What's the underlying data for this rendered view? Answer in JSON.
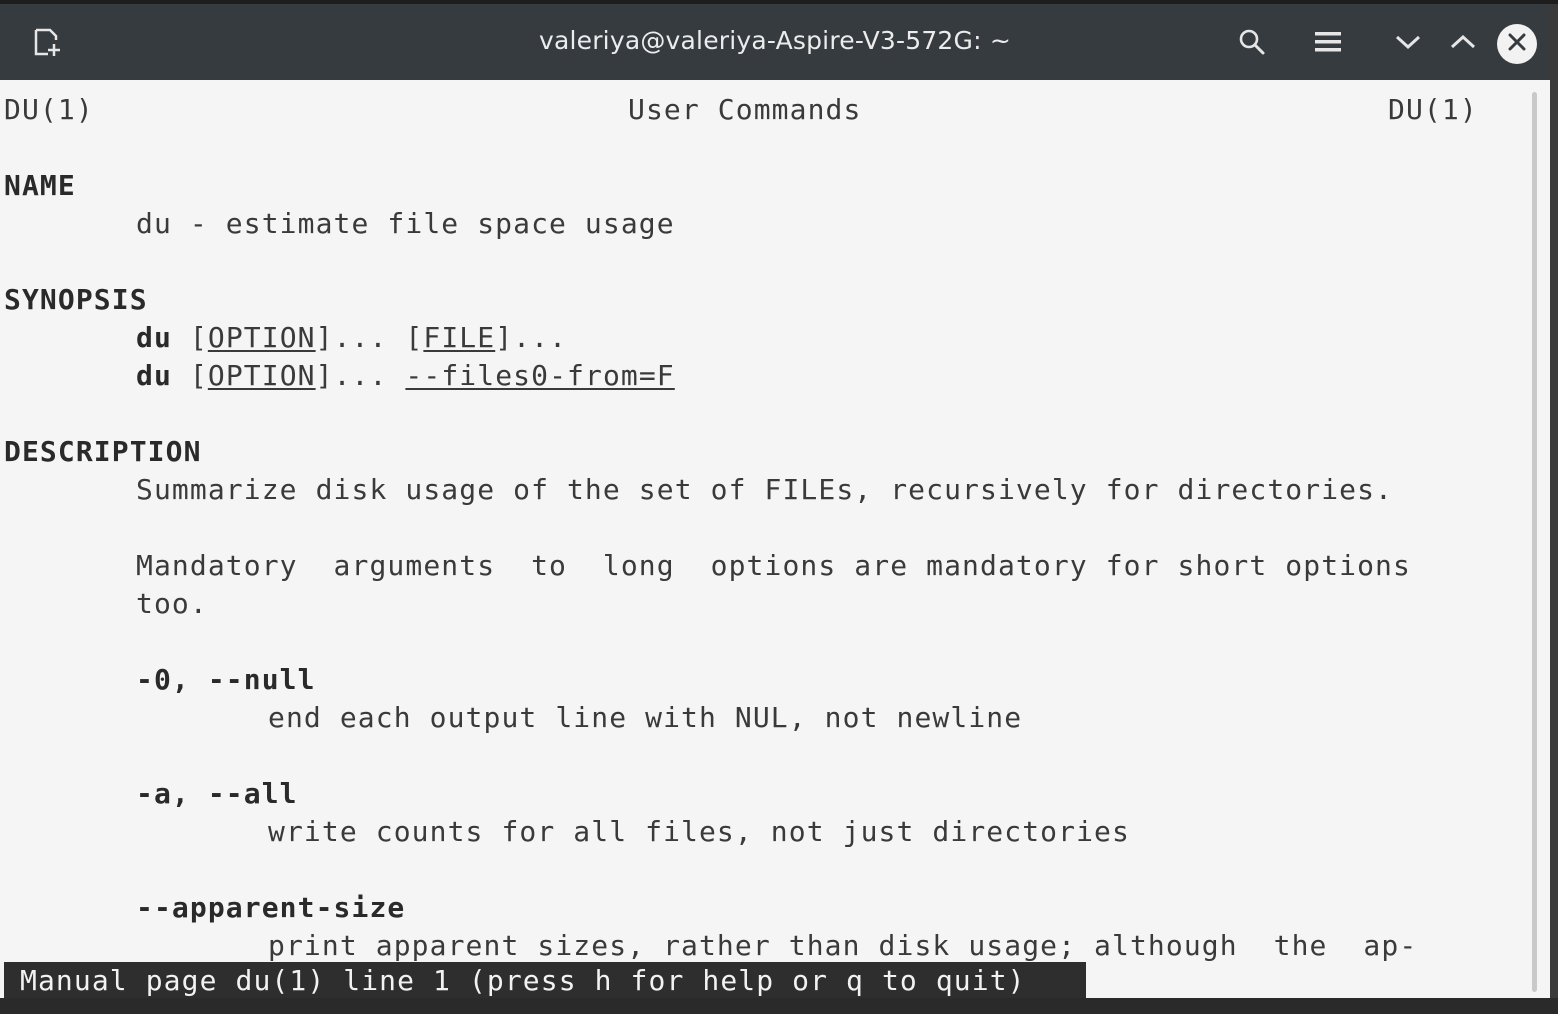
{
  "window": {
    "title": "valeriya@valeriya-Aspire-V3-572G: ~"
  },
  "titlebar_icons": {
    "new_tab": "new-tab-icon",
    "search": "search-icon",
    "menu": "hamburger-menu-icon",
    "minimize": "chevron-down-icon",
    "maximize": "chevron-up-icon",
    "close": "close-icon"
  },
  "manpage": {
    "header_left": "DU(1)",
    "header_center": "User Commands",
    "header_right": "DU(1)",
    "name_heading": "NAME",
    "name_line": "du - estimate file space usage",
    "synopsis_heading": "SYNOPSIS",
    "synopsis": [
      {
        "cmd": "du",
        "sp1": " ",
        "opt_open": "[",
        "opt": "OPTION",
        "opt_close": "]... ",
        "arg_pre": "[",
        "arg": "FILE",
        "arg_post": "]..."
      },
      {
        "cmd": "du",
        "sp1": " ",
        "opt_open": "[",
        "opt": "OPTION",
        "opt_close": "]... ",
        "arg_pre": "",
        "arg": "--files0-from=F",
        "arg_post": ""
      }
    ],
    "description_heading": "DESCRIPTION",
    "description_line1": "Summarize disk usage of the set of FILEs, recursively for directories.",
    "mandatory_line1": "Mandatory  arguments  to  long  options are mandatory for short options",
    "mandatory_line2": "too.",
    "options": [
      {
        "flag": "-0, --null",
        "desc": "end each output line with NUL, not newline"
      },
      {
        "flag": "-a, --all",
        "desc": "write counts for all files, not just directories"
      },
      {
        "flag": "--apparent-size",
        "desc": "print apparent sizes, rather than disk usage; although  the  ap-"
      }
    ],
    "status_bar": "Manual page du(1) line 1 (press h for help or q to quit)"
  }
}
